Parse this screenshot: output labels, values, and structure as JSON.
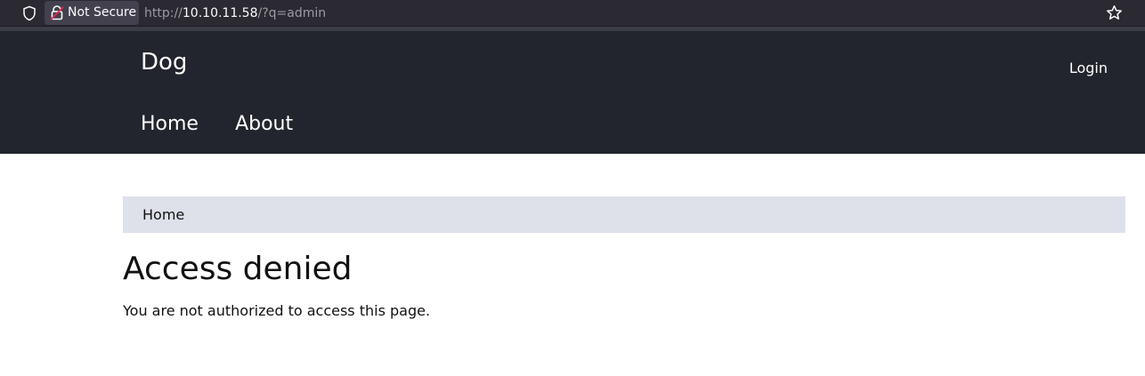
{
  "browser": {
    "security_label": "Not Secure",
    "url_scheme": "http://",
    "url_host": "10.10.11.58",
    "url_path": "/?q=admin"
  },
  "site": {
    "name": "Dog",
    "login_label": "Login",
    "nav": [
      {
        "label": "Home"
      },
      {
        "label": "About"
      }
    ]
  },
  "breadcrumb": {
    "items": [
      {
        "label": "Home"
      }
    ]
  },
  "content": {
    "title": "Access denied",
    "message": "You are not authorized to access this page."
  },
  "colors": {
    "header_bg": "#22252d",
    "breadcrumb_bg": "#dee1ea",
    "browser_bar_bg": "#2b2a33"
  }
}
